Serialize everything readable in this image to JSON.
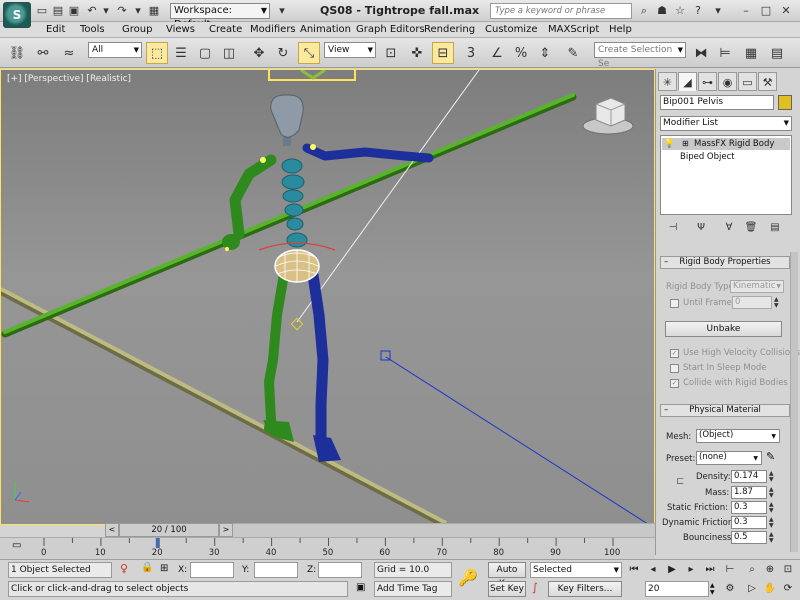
{
  "window": {
    "logo_text": "S",
    "workspace_label": "Workspace: Default",
    "title": "QS08 - Tightrope fall.max",
    "search_placeholder": "Type a keyword or phrase"
  },
  "menu": [
    "Edit",
    "Tools",
    "Group",
    "Views",
    "Create",
    "Modifiers",
    "Animation",
    "Graph Editors",
    "Rendering",
    "Customize",
    "MAXScript",
    "Help"
  ],
  "toolbar": {
    "selection_filter": "All",
    "reference_coord": "View",
    "snap_label": "3",
    "selection_set_placeholder": "Create Selection Se"
  },
  "viewport": {
    "label": "[+] [Perspective] [Realistic]"
  },
  "command_panel": {
    "object_name": "Bip001 Pelvis",
    "modifier_list": "Modifier List",
    "stack": [
      "MassFX Rigid Body",
      "Biped Object"
    ],
    "rigid_body": {
      "header": "Rigid Body Properties",
      "type_label": "Rigid Body Type:",
      "type_value": "Kinematic",
      "until_frame_label": "Until Frame:",
      "until_frame_value": "0",
      "unbake_label": "Unbake",
      "opt_high_velocity": "Use High Velocity Collisions",
      "opt_sleep": "Start In Sleep Mode",
      "opt_collide": "Collide with Rigid Bodies"
    },
    "physical": {
      "header": "Physical Material",
      "mesh_label": "Mesh:",
      "mesh_value": "(Object)",
      "preset_label": "Preset:",
      "preset_value": "(none)",
      "density_label": "Density:",
      "density": "0.174",
      "mass_label": "Mass:",
      "mass": "1.87",
      "static_label": "Static Friction:",
      "static_friction": "0.3",
      "dynamic_label": "Dynamic Friction:",
      "dynamic_friction": "0.3",
      "bounciness_label": "Bounciness:",
      "bounciness": "0.5"
    }
  },
  "timeline": {
    "slider_label": "20 / 100",
    "current_frame": 20,
    "ticks": [
      "0",
      "10",
      "20",
      "30",
      "40",
      "50",
      "60",
      "70",
      "80",
      "90",
      "100"
    ]
  },
  "status": {
    "selection_count": "1 Object Selected",
    "prompt": "Click or click-and-drag to select objects",
    "x_label": "X:",
    "y_label": "Y:",
    "z_label": "Z:",
    "grid": "Grid = 10.0",
    "add_time_tag": "Add Time Tag",
    "auto_key": "Auto Key",
    "set_key": "Set Key",
    "key_mode": "Selected",
    "key_filters": "Key Filters...",
    "frame_field": "20"
  },
  "colors": {
    "viewport_border": "#ffe259",
    "bone_green": "#2f8a1e",
    "bone_blue": "#1c2f9a",
    "bone_teal": "#2b8b9e",
    "pole_green": "#4aa01a",
    "rope": "#b9b77a"
  }
}
